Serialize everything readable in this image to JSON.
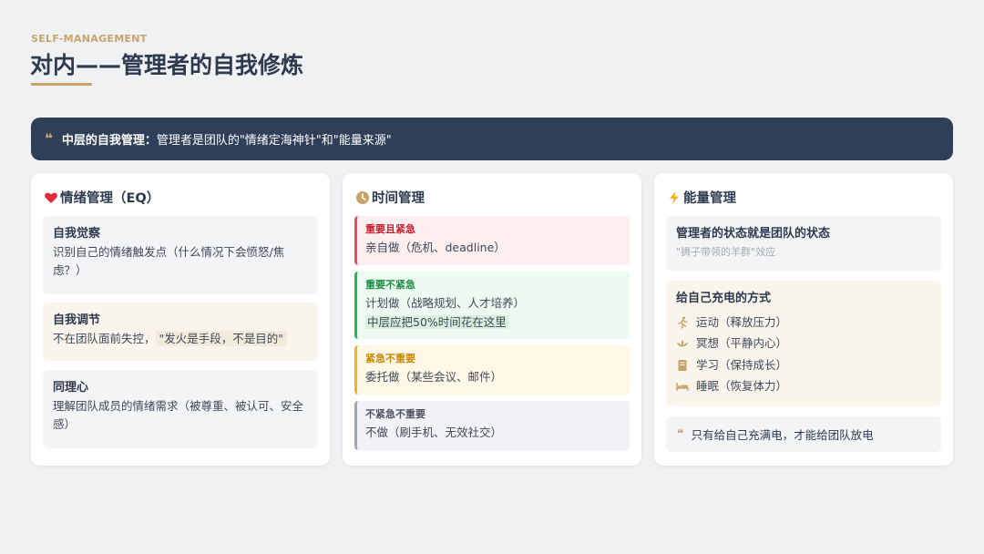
{
  "header": {
    "eyebrow": "SELF-MANAGEMENT",
    "title": "对内——管理者的自我修炼"
  },
  "banner": {
    "lead": "中层的自我管理：",
    "text": "管理者是团队的\"情绪定海神针\"和\"能量来源\""
  },
  "emotion": {
    "icon": "heart-icon",
    "title": "情绪管理（EQ）",
    "items": [
      {
        "title": "自我觉察",
        "desc": "识别自己的情绪触发点（什么情况下会愤怒/焦虑？）"
      },
      {
        "title": "自我调节",
        "desc_prefix": "不在团队面前失控，",
        "highlight": "\"发火是手段，不是目的\""
      },
      {
        "title": "同理心",
        "desc": "理解团队成员的情绪需求（被尊重、被认可、安全感）"
      }
    ]
  },
  "time": {
    "icon": "clock-icon",
    "title": "时间管理",
    "quadrants": [
      {
        "label": "重要且紧急",
        "desc": "亲自做（危机、deadline）"
      },
      {
        "label": "重要不紧急",
        "desc": "计划做（战略规划、人才培养）",
        "note": "中层应把50%时间花在这里"
      },
      {
        "label": "紧急不重要",
        "desc": "委托做（某些会议、邮件）"
      },
      {
        "label": "不紧急不重要",
        "desc": "不做（刷手机、无效社交）"
      }
    ],
    "colors": {
      "red": "#e44d5a",
      "green": "#21b65a",
      "yellow": "#f0b31f",
      "grey": "#a0a6b2"
    }
  },
  "energy": {
    "icon": "lightning-icon",
    "title": "能量管理",
    "state": {
      "title": "管理者的状态就是团队的状态",
      "sub": "\"狮子带领的羊群\"效应"
    },
    "recharge": {
      "title": "给自己充电的方式",
      "items": [
        {
          "icon": "running-icon",
          "label": "运动（释放压力）"
        },
        {
          "icon": "lotus-icon",
          "label": "冥想（平静内心）"
        },
        {
          "icon": "book-icon",
          "label": "学习（保持成长）"
        },
        {
          "icon": "bed-icon",
          "label": "睡眠（恢复体力）"
        }
      ]
    },
    "quote": "只有给自己充满电，才能给团队放电"
  },
  "colors": {
    "navy": "#2e3f57",
    "gold": "#c6a46b",
    "background": "#f0f1f3"
  }
}
